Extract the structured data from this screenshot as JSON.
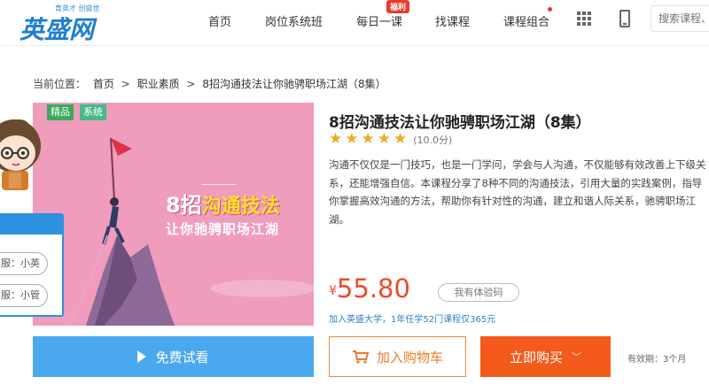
{
  "header": {
    "logo_slogan": "育英才 创盛世",
    "logo_text": "英盛网",
    "nav": [
      "首页",
      "岗位系统班",
      "每日一课",
      "找课程",
      "课程组合"
    ],
    "badge_fuli": "福利",
    "search_placeholder": "搜索课程、"
  },
  "breadcrumb": {
    "label": "当前位置：",
    "items": [
      "首页",
      "职业素质",
      "8招沟通技法让你驰骋职场江湖（8集）"
    ],
    "sep": ">"
  },
  "course_image": {
    "tags": [
      "精品",
      "系统"
    ],
    "headline_num": "8",
    "headline_rest": "招",
    "headline_highlight": "沟通技法",
    "subline": "让你驰骋职场江湖"
  },
  "side_panel": {
    "kefu": [
      "客服：小英",
      "客服：小管"
    ]
  },
  "course": {
    "title": "8招沟通技法让你驰骋职场江湖（8集）",
    "rating": 5,
    "score": "(10.0分)",
    "description": "沟通不仅仅是一门技巧，也是一门学问，学会与人沟通，不仅能够有效改善上下级关系，还能增强自信。本课程分享了8种不同的沟通技法，引用大量的实践案例，指导你掌握高效沟通的方法，帮助你有针对性的沟通，建立和谐人际关系，驰骋职场江湖。",
    "currency": "¥",
    "price": "55.80",
    "trial_code": "我有体验码",
    "promo": "加入英盛大学，1年任学52门课程仅365元"
  },
  "buttons": {
    "trial": "免费试看",
    "cart": "加入购物车",
    "buy": "立即购买",
    "validity": "有效期：3个月"
  },
  "colors": {
    "brand_blue": "#1f7fd1",
    "price_red": "#ef4a26",
    "trial_blue": "#4aa8ef",
    "buy_orange": "#f45a1b",
    "image_pink": "#ef9cbd"
  }
}
